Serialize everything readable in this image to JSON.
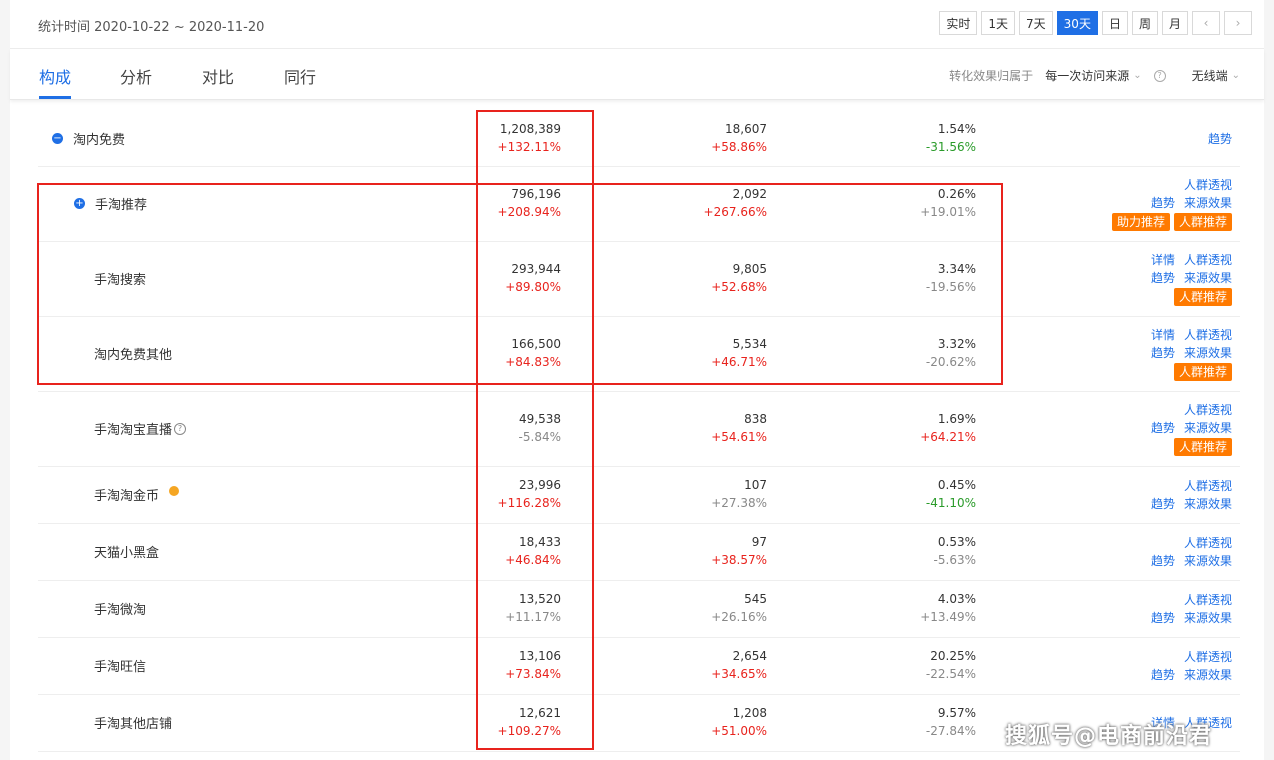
{
  "header": {
    "date_range": "统计时间 2020-10-22 ~ 2020-11-20",
    "periods": [
      "实时",
      "1天",
      "7天",
      "30天",
      "日",
      "周",
      "月"
    ],
    "active_period": "30天",
    "prev": "‹",
    "next": "›"
  },
  "tabs": [
    {
      "label": "构成"
    },
    {
      "label": "分析"
    },
    {
      "label": "对比"
    },
    {
      "label": "同行"
    }
  ],
  "attribution": {
    "label": "转化效果归属于",
    "selected": "每一次访问来源",
    "help": "?",
    "device": "无线端"
  },
  "rows": [
    {
      "name": "淘内免费",
      "toggle": "−",
      "v1": "1,208,389",
      "c1": "+132.11%",
      "v2": "18,607",
      "c2": "+58.86%",
      "v3": "1.54%",
      "c3": "-31.56%",
      "links": [
        [
          "趋势"
        ]
      ],
      "buttons": []
    },
    {
      "name": "手淘推荐",
      "toggle": "+",
      "v1": "796,196",
      "c1": "+208.94%",
      "v2": "2,092",
      "c2": "+267.66%",
      "v3": "0.26%",
      "c3": "+19.01%",
      "links": [
        [
          "人群透视"
        ],
        [
          "趋势",
          "来源效果"
        ]
      ],
      "buttons": [
        "助力推荐",
        "人群推荐"
      ]
    },
    {
      "name": "手淘搜索",
      "v1": "293,944",
      "c1": "+89.80%",
      "v2": "9,805",
      "c2": "+52.68%",
      "v3": "3.34%",
      "c3": "-19.56%",
      "links": [
        [
          "详情",
          "人群透视"
        ],
        [
          "趋势",
          "来源效果"
        ]
      ],
      "buttons": [
        "人群推荐"
      ]
    },
    {
      "name": "淘内免费其他",
      "v1": "166,500",
      "c1": "+84.83%",
      "v2": "5,534",
      "c2": "+46.71%",
      "v3": "3.32%",
      "c3": "-20.62%",
      "links": [
        [
          "详情",
          "人群透视"
        ],
        [
          "趋势",
          "来源效果"
        ]
      ],
      "buttons": [
        "人群推荐"
      ]
    },
    {
      "name": "手淘淘宝直播",
      "help": "?",
      "v1": "49,538",
      "c1": "-5.84%",
      "v2": "838",
      "c2": "+54.61%",
      "v3": "1.69%",
      "c3": "+64.21%",
      "links": [
        [
          "人群透视"
        ],
        [
          "趋势",
          "来源效果"
        ]
      ],
      "buttons": [
        "人群推荐"
      ]
    },
    {
      "name": "手淘淘金币",
      "dot": true,
      "v1": "23,996",
      "c1": "+116.28%",
      "v2": "107",
      "c2": "+27.38%",
      "v3": "0.45%",
      "c3": "-41.10%",
      "links": [
        [
          "人群透视"
        ],
        [
          "趋势",
          "来源效果"
        ]
      ],
      "buttons": []
    },
    {
      "name": "天猫小黑盒",
      "v1": "18,433",
      "c1": "+46.84%",
      "v2": "97",
      "c2": "+38.57%",
      "v3": "0.53%",
      "c3": "-5.63%",
      "links": [
        [
          "人群透视"
        ],
        [
          "趋势",
          "来源效果"
        ]
      ],
      "buttons": []
    },
    {
      "name": "手淘微淘",
      "v1": "13,520",
      "c1": "+11.17%",
      "v2": "545",
      "c2": "+26.16%",
      "v3": "4.03%",
      "c3": "+13.49%",
      "links": [
        [
          "人群透视"
        ],
        [
          "趋势",
          "来源效果"
        ]
      ],
      "buttons": []
    },
    {
      "name": "手淘旺信",
      "v1": "13,106",
      "c1": "+73.84%",
      "v2": "2,654",
      "c2": "+34.65%",
      "v3": "20.25%",
      "c3": "-22.54%",
      "links": [
        [
          "人群透视"
        ],
        [
          "趋势",
          "来源效果"
        ]
      ],
      "buttons": []
    },
    {
      "name": "手淘其他店铺",
      "v1": "12,621",
      "c1": "+109.27%",
      "v2": "1,208",
      "c2": "+51.00%",
      "v3": "9.57%",
      "c3": "-27.84%",
      "links": [
        [
          "详情",
          "人群透视"
        ]
      ],
      "buttons": []
    }
  ],
  "colors": {
    "accent": "#1f6fe5",
    "up": "#e8231d",
    "down_good": "#2a9b2a",
    "neutral": "#888888",
    "badge": "#ff7a00",
    "highlight": "#e8231d"
  },
  "watermark": "搜狐号@电商前沿君"
}
